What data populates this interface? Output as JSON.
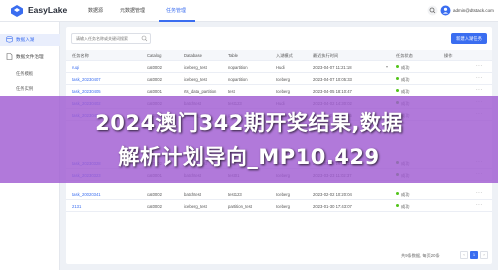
{
  "header": {
    "brand": "EasyLake",
    "tabs": [
      {
        "label": "数据源"
      },
      {
        "label": "元数据管理"
      },
      {
        "label": "任务管理"
      }
    ],
    "user": "admin@dtstack.com"
  },
  "sidebar": {
    "items": [
      {
        "label": "数据入湖"
      },
      {
        "label": "数据文件治理"
      }
    ],
    "subitems": [
      {
        "label": "任务模板"
      },
      {
        "label": "任务实例"
      }
    ]
  },
  "toolbar": {
    "search_placeholder": "请输入任务名称或关键词搜索",
    "create_label": "新建入湖任务"
  },
  "table": {
    "columns": [
      "任务名称",
      "Catalog",
      "Database",
      "Table",
      "入湖模式",
      "最近执行时间",
      "任务状态",
      "操作"
    ],
    "rows": [
      {
        "name": "ruqi",
        "catalog": "cat0002",
        "database": "iceberg_test",
        "table": "nopartition",
        "mode": "Hudi",
        "time": "2023-04-07 11:21:18",
        "status": "成功"
      },
      {
        "name": "task_20230407",
        "catalog": "cat0002",
        "database": "iceberg_test",
        "table": "nopartition",
        "mode": "Iceberg",
        "time": "2023-04-07 10:05:33",
        "status": "成功"
      },
      {
        "name": "task_20230405",
        "catalog": "cat0001",
        "database": "rts_data_partition",
        "table": "test",
        "mode": "Iceberg",
        "time": "2023-04-05 18:10:47",
        "status": "成功"
      },
      {
        "name": "task_20230402",
        "catalog": "cat0002",
        "database": "batchtest",
        "table": "test123",
        "mode": "Hudi",
        "time": "2023-04-02 14:30:02",
        "status": "成功"
      },
      {
        "name": "task_20230401",
        "catalog": "cat0001",
        "database": "iceberg_test",
        "table": "partition",
        "mode": "Iceberg",
        "time": "2023-04-01 09:12:45",
        "status": "成功"
      },
      {
        "name": "task_20230328",
        "catalog": "cat0002",
        "database": "iceberg_test",
        "table": "test",
        "mode": "Hudi",
        "time": "2023-03-28 16:40:11",
        "status": "成功"
      },
      {
        "name": "task_20230323",
        "catalog": "cat0001",
        "database": "batchtest",
        "table": "test01",
        "mode": "Iceberg",
        "time": "2023-03-23 11:02:37",
        "status": "成功"
      },
      {
        "name": "task_20020341",
        "catalog": "cat0002",
        "database": "batchtest",
        "table": "test123",
        "mode": "Iceberg",
        "time": "2023-02-02 10:20:04",
        "status": "成功"
      },
      {
        "name": "2131",
        "catalog": "cat0002",
        "database": "iceberg_test",
        "table": "partition_test",
        "mode": "Iceberg",
        "time": "2023-01-30 17:43:07",
        "status": "成功"
      }
    ]
  },
  "pagination": {
    "total_text": "共9条数据, 每页20条",
    "current_page": "1",
    "prev_symbol": "‹",
    "next_symbol": "›"
  },
  "overlay": {
    "line1": "2024澳门342期开奖结果,数据",
    "line2": "解析计划导向_MP10.429"
  },
  "colors": {
    "accent": "#3a6df0",
    "success": "#52c41a",
    "overlay": "#a05cd2"
  }
}
